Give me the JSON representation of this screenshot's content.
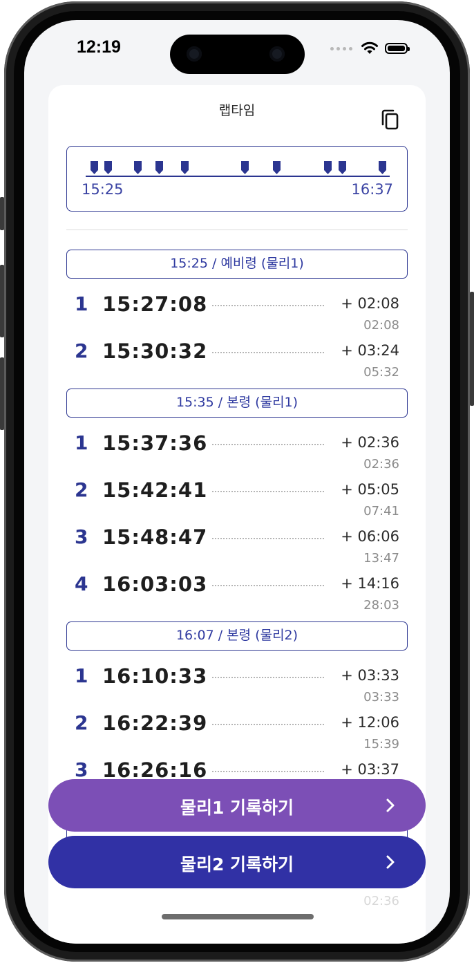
{
  "status_bar": {
    "time": "12:19"
  },
  "header": {
    "title": "랩타임",
    "copy_icon": "copy-icon"
  },
  "timeline": {
    "start_label": "15:25",
    "end_label": "16:37",
    "marker_count": 10,
    "accent_color": "#2b3590"
  },
  "sections": [
    {
      "header": "15:25 / 예비령 (물리1)",
      "laps": [
        {
          "num": "1",
          "time": "15:27:08",
          "delta": "+ 02:08",
          "total": "02:08"
        },
        {
          "num": "2",
          "time": "15:30:32",
          "delta": "+ 03:24",
          "total": "05:32"
        }
      ]
    },
    {
      "header": "15:35 / 본령 (물리1)",
      "laps": [
        {
          "num": "1",
          "time": "15:37:36",
          "delta": "+ 02:36",
          "total": "02:36"
        },
        {
          "num": "2",
          "time": "15:42:41",
          "delta": "+ 05:05",
          "total": "07:41"
        },
        {
          "num": "3",
          "time": "15:48:47",
          "delta": "+ 06:06",
          "total": "13:47"
        },
        {
          "num": "4",
          "time": "16:03:03",
          "delta": "+ 14:16",
          "total": "28:03"
        }
      ]
    },
    {
      "header": "16:07 / 본령 (물리2)",
      "laps": [
        {
          "num": "1",
          "time": "16:10:33",
          "delta": "+ 03:33",
          "total": "03:33"
        },
        {
          "num": "2",
          "time": "16:22:39",
          "delta": "+ 12:06",
          "total": "15:39"
        },
        {
          "num": "3",
          "time": "16:26:16",
          "delta": "+ 03:37",
          "total": ""
        }
      ]
    }
  ],
  "partially_hidden_total": "02:36",
  "buttons": {
    "record1": {
      "label": "물리1 기록하기",
      "color": "#7c4fb6"
    },
    "record2": {
      "label": "물리2 기록하기",
      "color": "#3131a5"
    }
  }
}
